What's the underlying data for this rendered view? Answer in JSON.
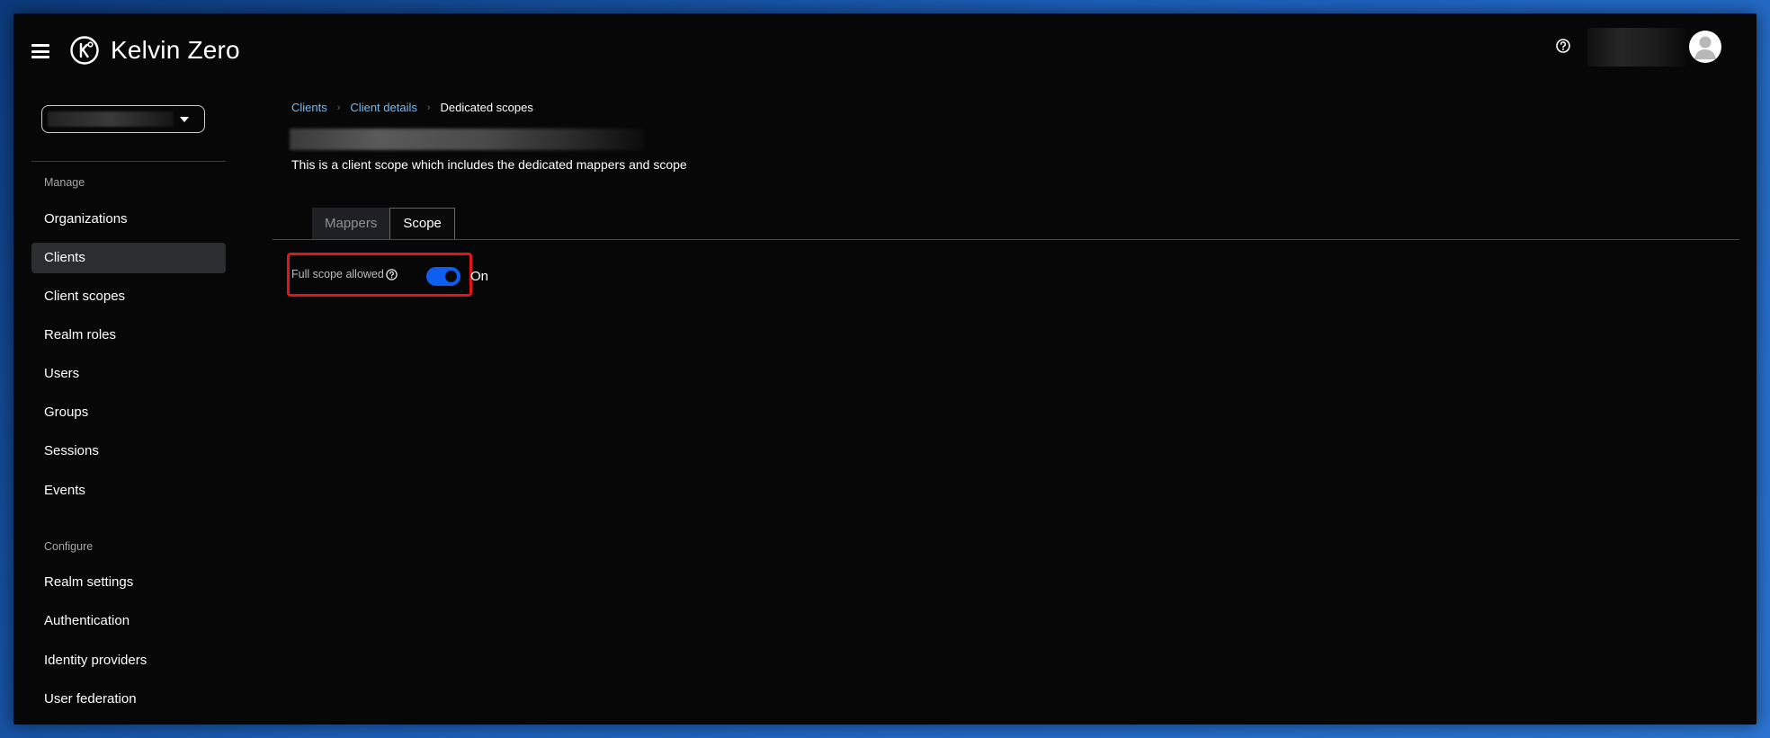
{
  "brand": {
    "name": "Kelvin Zero",
    "logo_icon": "kelvin-zero-logo-icon"
  },
  "header": {
    "help_icon": "help-circle-icon",
    "avatar_icon": "user-avatar-icon"
  },
  "sidebar": {
    "realm_caret_icon": "caret-down-icon",
    "sections": [
      {
        "label": "Manage",
        "items": [
          "Organizations",
          "Clients",
          "Client scopes",
          "Realm roles",
          "Users",
          "Groups",
          "Sessions",
          "Events"
        ]
      },
      {
        "label": "Configure",
        "items": [
          "Realm settings",
          "Authentication",
          "Identity providers",
          "User federation"
        ]
      }
    ],
    "active_item": "Clients"
  },
  "breadcrumb": {
    "items": [
      "Clients",
      "Client details"
    ],
    "current": "Dedicated scopes"
  },
  "page": {
    "description": "This is a client scope which includes the dedicated mappers and scope"
  },
  "tabs": {
    "items": [
      "Mappers",
      "Scope"
    ],
    "active": "Scope"
  },
  "scope_form": {
    "full_scope_label": "Full scope allowed",
    "full_scope_help_icon": "help-circle-icon",
    "full_scope_value": "On",
    "toggle_color": "#0e5ff0"
  },
  "colors": {
    "link": "#73bcf7",
    "highlight": "#e3141b",
    "tab_active_border": "#1a6fe8"
  }
}
